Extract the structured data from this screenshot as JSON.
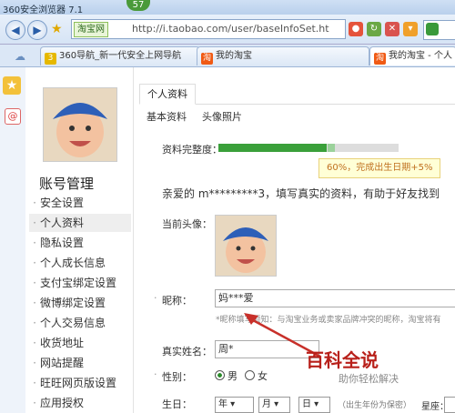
{
  "browser": {
    "title": "360安全浏览器 7.1",
    "badge": "57",
    "site_tag": "淘宝网",
    "url": "http://i.taobao.com/user/baseInfoSet.ht",
    "tabs": [
      {
        "icon": "360-icon",
        "label": "360导航_新一代安全上网导航"
      },
      {
        "icon": "taobao-icon",
        "label": "我的淘宝"
      },
      {
        "icon": "taobao-icon",
        "label": "我的淘宝 - 个人"
      }
    ]
  },
  "sidebar": {
    "title": "账号管理",
    "items": [
      {
        "label": "安全设置"
      },
      {
        "label": "个人资料"
      },
      {
        "label": "隐私设置"
      },
      {
        "label": "个人成长信息"
      },
      {
        "label": "支付宝绑定设置"
      },
      {
        "label": "微博绑定设置"
      },
      {
        "label": "个人交易信息"
      },
      {
        "label": "收货地址"
      },
      {
        "label": "网站提醒"
      },
      {
        "label": "旺旺网页版设置"
      },
      {
        "label": "应用授权"
      }
    ]
  },
  "main": {
    "tab": "个人资料",
    "subtabs": [
      "基本资料",
      "头像照片"
    ],
    "completeness_label": "资料完整度：",
    "completeness": 0.6,
    "tip": "60%，完成出生日期+5%",
    "greeting": "亲爱的 m*********3，填写真实的资料，有助于好友找到",
    "avatar_label": "当前头像：",
    "nickname_label": "昵称：",
    "nickname_value": "妈***爱",
    "nickname_hint": "*昵称填写须知：与淘宝业务或卖家品牌冲突的昵称，淘宝将有",
    "realname_label": "真实姓名：",
    "realname_value": "周*",
    "gender_label": "性别：",
    "gender_options": [
      "男",
      "女"
    ],
    "birthday_label": "生日：",
    "year": "年",
    "month": "月",
    "day": "日",
    "birthday_note": "（出生年份为保密）",
    "zodiac_label": "星座："
  },
  "watermark": {
    "big": "百科全说",
    "small": "助你轻松解决"
  },
  "colors": {
    "progress": "#3aa03a",
    "arrow": "#c8302a",
    "tip_text": "#c07020"
  }
}
